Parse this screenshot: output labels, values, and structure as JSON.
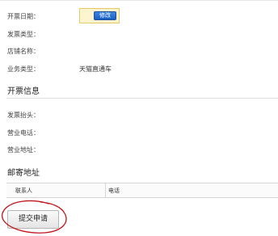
{
  "invoice_fields": {
    "date_label": "开票日期：",
    "edit_label": "修改",
    "type_label": "发票类型：",
    "store_label": "店铺名称：",
    "business_label": "业务类型：",
    "business_value": "天猫直通车"
  },
  "invoice_info": {
    "title": "开票信息",
    "header_label": "发票抬头：",
    "phone_label": "营业电话：",
    "address_label": "营业地址："
  },
  "mailing": {
    "title": "邮寄地址",
    "columns": [
      "联系人",
      "电话"
    ]
  },
  "actions": {
    "submit_label": "提交申请"
  },
  "colors": {
    "edit_button": "#1a5fc4",
    "highlight_bg": "#fdf5d0",
    "annotation_circle": "#c0161a"
  }
}
